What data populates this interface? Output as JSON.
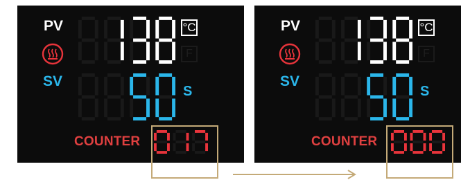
{
  "colors": {
    "panel_bg": "#0c0c0c",
    "pv": "#ffffff",
    "sv": "#2bb6ea",
    "counter": "#e8343b",
    "unlit": "#191919",
    "highlight": "#c4aa78"
  },
  "panels": [
    {
      "pv_label": "PV",
      "pv_value": "138",
      "unit_c": "°C",
      "unit_f": "F",
      "sv_label": "SV",
      "sv_value": "50",
      "sv_unit": "S",
      "counter_label": "COUNTER",
      "counter_value": "017"
    },
    {
      "pv_label": "PV",
      "pv_value": "138",
      "unit_c": "°C",
      "unit_f": "F",
      "sv_label": "SV",
      "sv_value": "50",
      "sv_unit": "S",
      "counter_label": "COUNTER",
      "counter_value": "000"
    }
  ],
  "icons": {
    "heat": "heating-icon",
    "arrow": "right-arrow-icon"
  }
}
